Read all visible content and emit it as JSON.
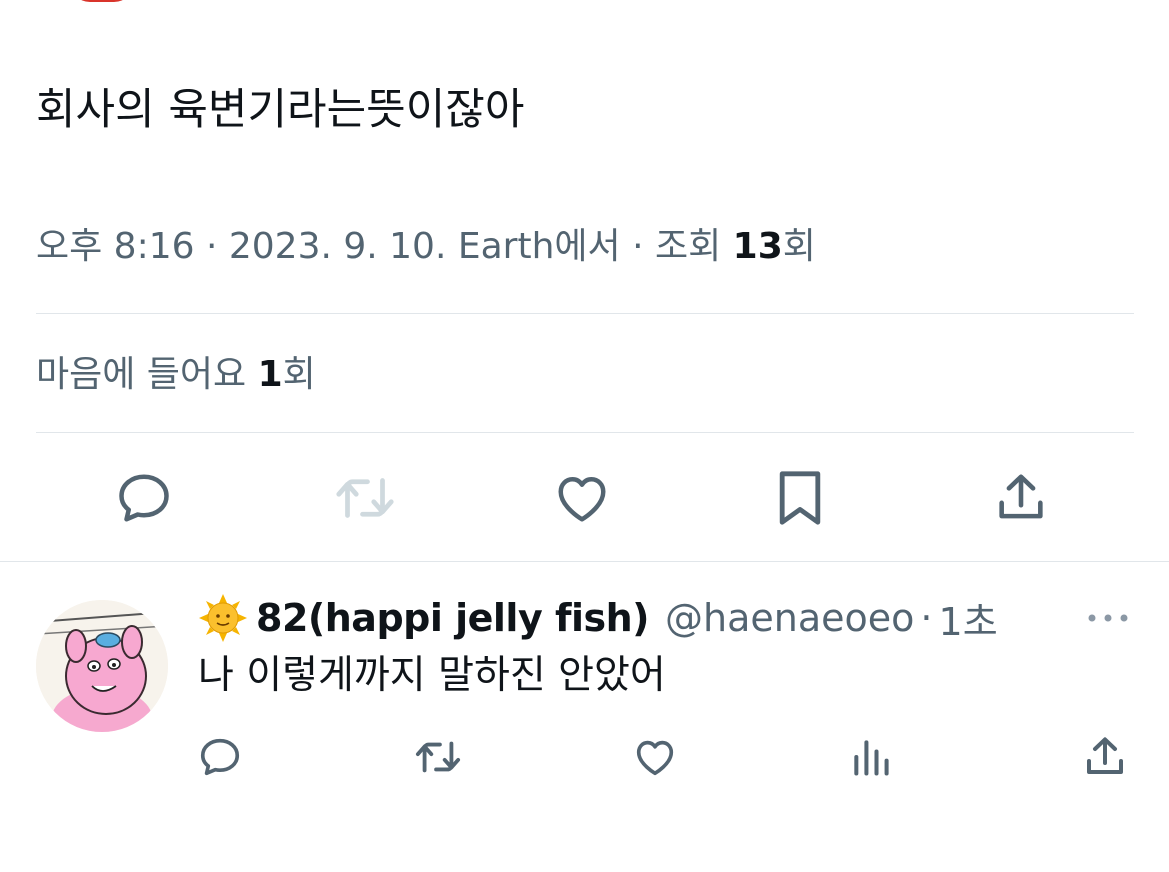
{
  "tweet": {
    "text": "회사의 육변기라는뜻이잖아",
    "meta_time": "오후 8:16 · 2023. 9. 10. Earth에서 · 조회 ",
    "views_count": "13",
    "views_suffix": "회",
    "likes_label": "마음에 들어요 ",
    "likes_count": "1",
    "likes_suffix": "회"
  },
  "actions": {
    "icons": [
      "reply-icon",
      "retweet-icon",
      "like-icon",
      "bookmark-icon",
      "share-icon"
    ],
    "retweet_disabled": true
  },
  "reply": {
    "emoji": "🌞",
    "display_name": "82(happi jelly fish)",
    "handle": "@haenaeoeo",
    "separator": "·",
    "time": "1초",
    "text": "나 이렇게까지 말하진 안았어",
    "icons": [
      "reply-icon",
      "retweet-icon",
      "like-icon",
      "views-icon",
      "share-icon"
    ]
  },
  "colors": {
    "text_primary": "#0f1419",
    "text_secondary": "#536471",
    "divider": "#e1e6ea",
    "icon": "#536471",
    "icon_disabled": "#cfd9de"
  }
}
